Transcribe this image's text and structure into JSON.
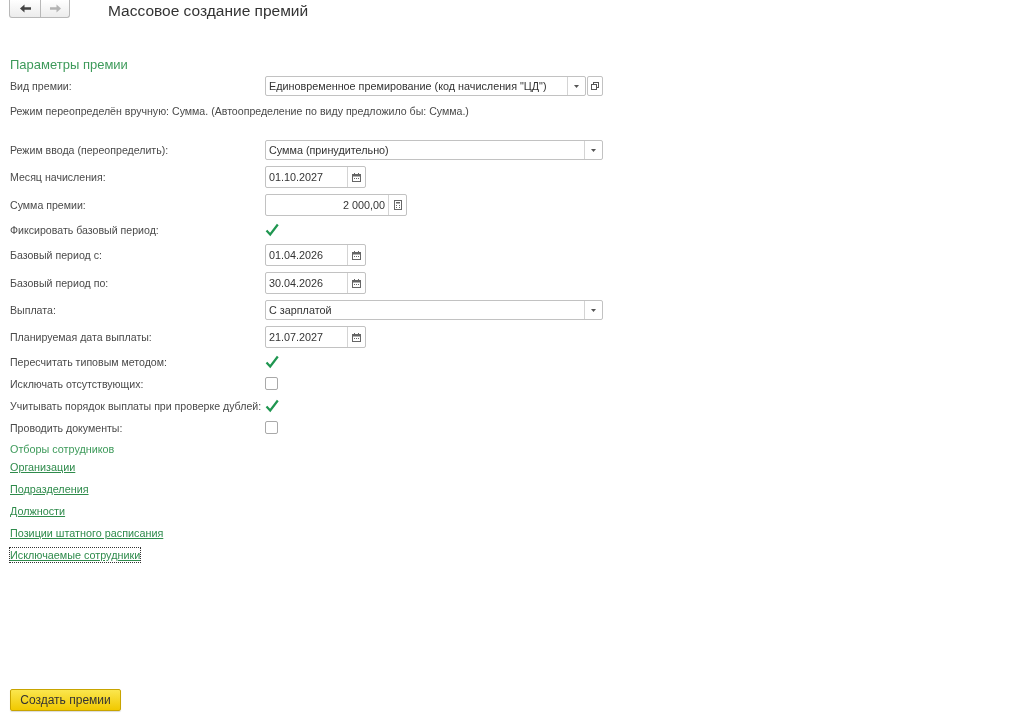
{
  "nav_buttons": [
    {
      "kind": "back",
      "disabled": false
    },
    {
      "kind": "forward",
      "disabled": true
    }
  ],
  "window": {
    "title": "Массовое создание премий"
  },
  "parameters": {
    "title": "Параметры премии",
    "fields": [
      {
        "kind": "select",
        "label": "Вид премии:",
        "value": "Единовременное премирование (код начисления \"ЦД\")",
        "open_button": true
      },
      {
        "kind": "note",
        "text": "Режим переопределён вручную: Сумма. (Автоопределение по виду предложило бы: Сумма.)"
      },
      {
        "kind": "select",
        "label": "Режим ввода (переопределить):",
        "value": "Сумма (принудительно)",
        "open_button": false
      },
      {
        "kind": "date",
        "label": "Месяц начисления:",
        "value": "01.10.2027"
      },
      {
        "kind": "number",
        "label": "Сумма премии:",
        "value": "2 000,00"
      },
      {
        "kind": "checkbox",
        "label": "Фиксировать базовый период:",
        "checked": true
      },
      {
        "kind": "date",
        "label": "Базовый период с:",
        "value": "01.04.2026"
      },
      {
        "kind": "date",
        "label": "Базовый период по:",
        "value": "30.04.2026"
      },
      {
        "kind": "select",
        "label": "Выплата:",
        "value": "С зарплатой",
        "open_button": false
      },
      {
        "kind": "date",
        "label": "Планируемая дата выплаты:",
        "value": "21.07.2027"
      },
      {
        "kind": "checkbox",
        "label": "Пересчитать типовым методом:",
        "checked": true
      },
      {
        "kind": "checkbox",
        "label": "Исключать отсутствующих:",
        "checked": false
      },
      {
        "kind": "checkbox",
        "label": "Учитывать порядок выплаты при проверке дублей:",
        "checked": true
      },
      {
        "kind": "checkbox",
        "label": "Проводить документы:",
        "checked": false
      }
    ]
  },
  "employee_filters": {
    "title": "Отборы сотрудников",
    "links": [
      {
        "label": "Организации",
        "focused": false
      },
      {
        "label": "Подразделения",
        "focused": false
      },
      {
        "label": "Должности",
        "focused": false
      },
      {
        "label": "Позиции штатного расписания",
        "focused": false
      },
      {
        "label": "Исключаемые сотрудники",
        "focused": true
      }
    ]
  },
  "create_button": {
    "label": "Создать премии"
  }
}
